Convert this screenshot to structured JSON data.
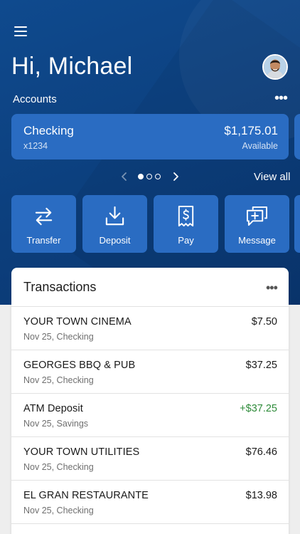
{
  "header": {
    "greeting": "Hi, Michael"
  },
  "accounts": {
    "label": "Accounts",
    "card": {
      "name": "Checking",
      "number": "x1234",
      "balance": "$1,175.01",
      "balance_label": "Available"
    },
    "pager": {
      "pages": 3,
      "active": 1
    },
    "view_all": "View all"
  },
  "actions": [
    {
      "label": "Transfer",
      "icon": "transfer-icon"
    },
    {
      "label": "Deposit",
      "icon": "deposit-icon"
    },
    {
      "label": "Pay",
      "icon": "bill-pay-icon"
    },
    {
      "label": "Message",
      "icon": "message-icon"
    }
  ],
  "transactions": {
    "title": "Transactions",
    "items": [
      {
        "merchant": "YOUR TOWN CINEMA",
        "meta": "Nov 25, Checking",
        "amount": "$7.50",
        "credit": false
      },
      {
        "merchant": "GEORGES BBQ & PUB",
        "meta": "Nov 25, Checking",
        "amount": "$37.25",
        "credit": false
      },
      {
        "merchant": "ATM Deposit",
        "meta": "Nov 25, Savings",
        "amount": "+$37.25",
        "credit": true
      },
      {
        "merchant": "YOUR TOWN UTILITIES",
        "meta": "Nov 25, Checking",
        "amount": "$76.46",
        "credit": false
      },
      {
        "merchant": "EL GRAN RESTAURANTE",
        "meta": "Nov 25, Checking",
        "amount": "$13.98",
        "credit": false
      }
    ]
  },
  "colors": {
    "hero_background": "#0c3f7d",
    "card_background": "#2a6cc2",
    "credit_amount": "#2e8b3a"
  }
}
